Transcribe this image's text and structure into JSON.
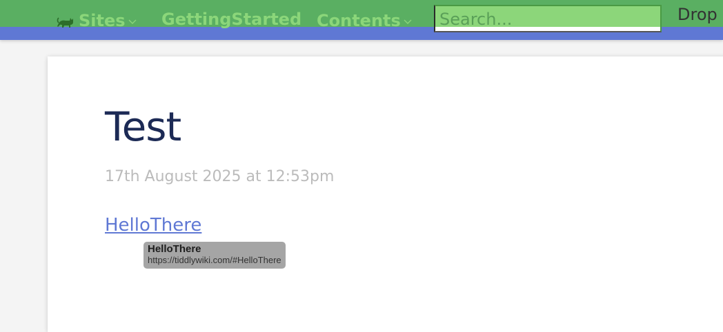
{
  "colors": {
    "topbar_green": "#5aaf62",
    "topbar_blue": "#5f78d4",
    "nav_text": "#8bd67a",
    "search_bg": "#8cd67a",
    "title": "#1c2a55",
    "subtitle": "#bbbbbb",
    "link": "#5f78d4",
    "tooltip_bg": "#a5a5a5"
  },
  "topbar": {
    "sites_icon": "cat-icon",
    "sites_label": "Sites",
    "getting_started_label": "GettingStarted",
    "contents_label": "Contents",
    "chevron_icon": "chevron-down-icon",
    "search_placeholder": "Search...",
    "drop_label": "Drop"
  },
  "tiddler": {
    "title": "Test",
    "modified": "17th August 2025 at 12:53pm",
    "link_text": "HelloThere"
  },
  "tooltip": {
    "title": "HelloThere",
    "url": "https://tiddlywiki.com/#HelloThere"
  }
}
